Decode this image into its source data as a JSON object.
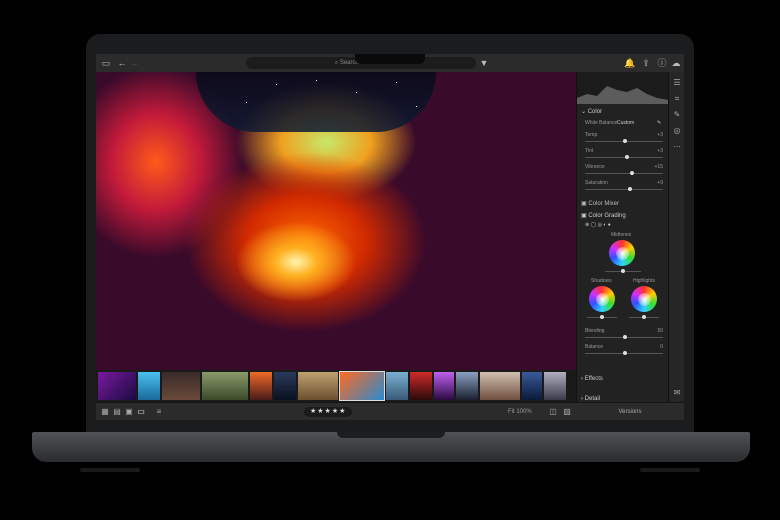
{
  "topbar": {
    "search_placeholder": "Search All Photos",
    "back_icon": "back-arrow-icon",
    "panel_icon": "panel-toggle-icon"
  },
  "panel": {
    "color": {
      "title": "Color",
      "white_balance_label": "White Balance",
      "white_balance_value": "Custom"
    },
    "sliders": [
      {
        "label": "Temp",
        "value": "+3",
        "level": 0.5
      },
      {
        "label": "Tint",
        "value": "+3",
        "level": 0.52
      },
      {
        "label": "Vibrance",
        "value": "+15",
        "level": 0.58
      },
      {
        "label": "Saturation",
        "value": "+9",
        "level": 0.55
      }
    ],
    "color_mixer": "Color Mixer",
    "color_grading": "Color Grading",
    "midtones": "Midtones",
    "shadows": "Shadows",
    "highlights": "Highlights",
    "blending": {
      "label": "Blending",
      "value": "50"
    },
    "balance": {
      "label": "Balance",
      "value": "0"
    },
    "effects": "Effects",
    "detail": "Detail",
    "versions": "Versions"
  },
  "bottombar": {
    "stars": "★★★★★",
    "fit": "Fit  100%"
  },
  "accent": "#3aa0ff"
}
